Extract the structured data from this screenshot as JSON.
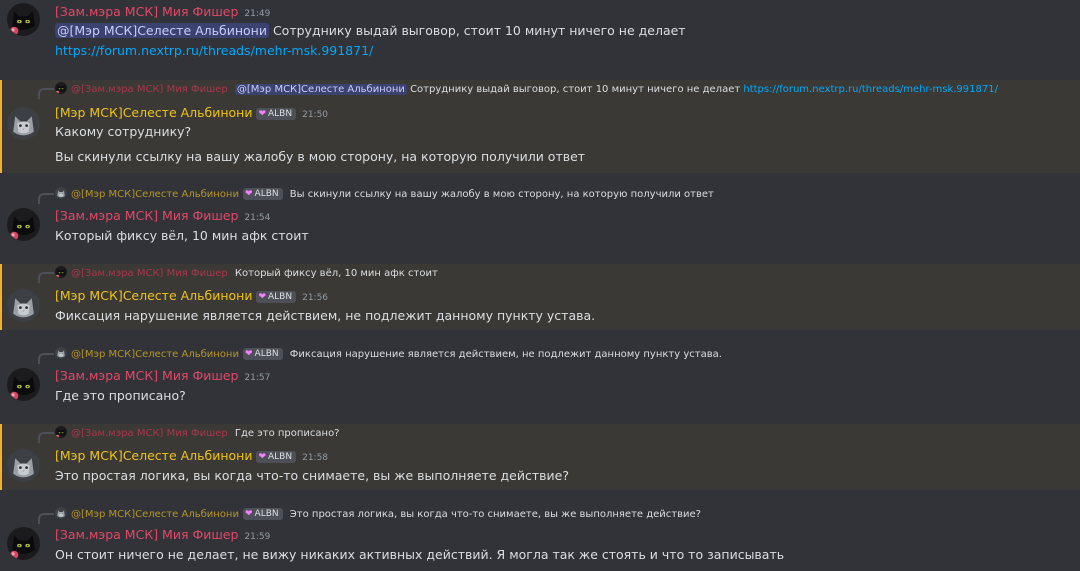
{
  "colors": {
    "background": "#313338",
    "highlight": "#3a3935",
    "mia_name": "#e34867",
    "celeste_name": "#f0c21a",
    "link": "#00a8fc",
    "mention_bg": "#3c4270"
  },
  "users": {
    "mia": {
      "name": "[Зам.мэра МСК] Мия Фишер",
      "avatar_icon": "black-cat-avatar-icon"
    },
    "celeste": {
      "name": "[Мэр МСК]Селесте Альбинони",
      "avatar_icon": "gray-cat-avatar-icon",
      "tag_icon": "heart-icon",
      "tag": "ALBN"
    }
  },
  "messages": [
    {
      "author": "[Зам.мэра МСК] Мия Фишер",
      "time": "21:49",
      "mention": "@[Мэр МСК]Селесте Альбинони",
      "text": "Сотруднику выдай выговор, стоит 10 минут ничего не делает",
      "link": "https://forum.nextrp.ru/threads/mehr-msk.991871/"
    },
    {
      "reply": {
        "author": "@[Зам.мэра МСК] Мия Фишер",
        "mention": "@[Мэр МСК]Селесте Альбинони",
        "text": "Сотруднику выдай выговор, стоит 10 минут ничего не делает",
        "link": "https://forum.nextrp.ru/threads/mehr-msk.991871/"
      },
      "author": "[Мэр МСК]Селесте Альбинони",
      "tag": "ALBN",
      "time": "21:50",
      "text": "Какому сотруднику?",
      "text2": "Вы скинули ссылку на вашу жалобу в мою сторону, на которую получили ответ"
    },
    {
      "reply": {
        "author": "@[Мэр МСК]Селесте Альбинони",
        "tag": "ALBN",
        "text": "Вы скинули ссылку на вашу жалобу в мою сторону, на которую получили ответ"
      },
      "author": "[Зам.мэра МСК] Мия Фишер",
      "time": "21:54",
      "text": "Который фиксу вёл, 10 мин афк стоит"
    },
    {
      "reply": {
        "author": "@[Зам.мэра МСК] Мия Фишер",
        "text": "Который фиксу вёл, 10 мин афк стоит"
      },
      "author": "[Мэр МСК]Селесте Альбинони",
      "tag": "ALBN",
      "time": "21:56",
      "text": "Фиксация нарушение является действием, не подлежит данному пункту устава."
    },
    {
      "reply": {
        "author": "@[Мэр МСК]Селесте Альбинони",
        "tag": "ALBN",
        "text": "Фиксация нарушение является действием, не подлежит данному пункту устава."
      },
      "author": "[Зам.мэра МСК] Мия Фишер",
      "time": "21:57",
      "text": "Где это прописано?"
    },
    {
      "reply": {
        "author": "@[Зам.мэра МСК] Мия Фишер",
        "text": "Где это прописано?"
      },
      "author": "[Мэр МСК]Селесте Альбинони",
      "tag": "ALBN",
      "time": "21:58",
      "text": "Это простая логика, вы когда что-то снимаете, вы же выполняете действие?"
    },
    {
      "reply": {
        "author": "@[Мэр МСК]Селесте Альбинони",
        "tag": "ALBN",
        "text": "Это простая логика, вы когда что-то снимаете, вы же выполняете действие?"
      },
      "author": "[Зам.мэра МСК] Мия Фишер",
      "time": "21:59",
      "text": "Он стоит ничего не делает, не вижу никаких активных действий. Я могла так же стоять и что то записывать"
    }
  ]
}
